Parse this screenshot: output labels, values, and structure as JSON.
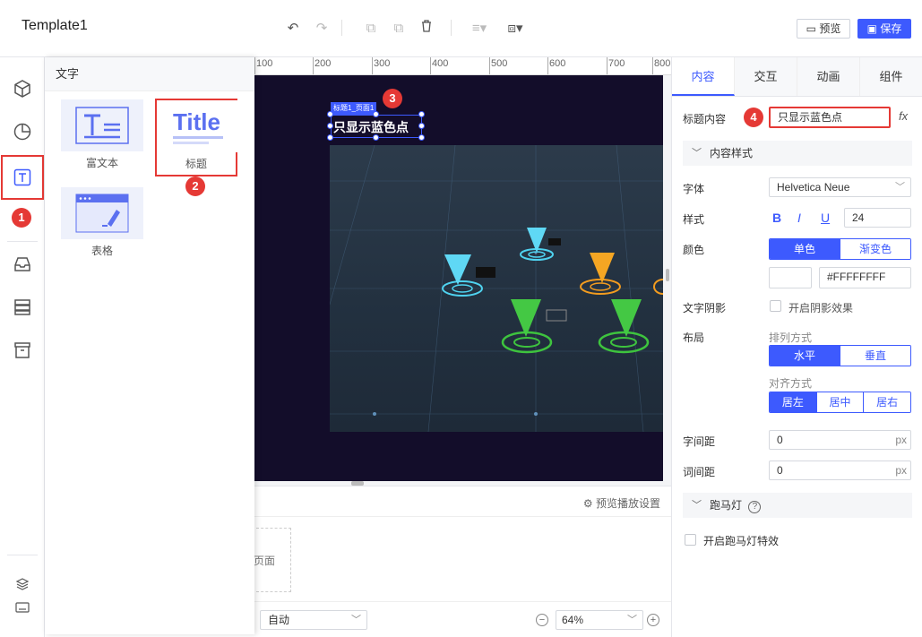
{
  "app": {
    "title": "Template1"
  },
  "toolbar": {
    "undo_icon": "undo-icon",
    "redo_icon": "redo-icon",
    "preview_label": "预览",
    "save_label": "保存"
  },
  "flyout": {
    "header": "文字",
    "items": [
      {
        "label": "富文本",
        "icon": "rich-text-icon"
      },
      {
        "label": "标题",
        "icon": "title-icon",
        "thumb_text": "Title"
      },
      {
        "label": "表格",
        "icon": "table-icon"
      }
    ]
  },
  "ruler": {
    "labels": [
      "200",
      "100",
      "100",
      "200",
      "300",
      "400",
      "500",
      "600",
      "700",
      "800"
    ]
  },
  "canvas": {
    "widget_tag": "标题1_页面1",
    "widget_text": "只显示蓝色点"
  },
  "badges": [
    "1",
    "2",
    "3",
    "4"
  ],
  "bottom": {
    "play_settings": "预览播放设置",
    "page_label": "页面",
    "auto_value": "自动",
    "zoom_value": "64%"
  },
  "panel": {
    "tabs": [
      "内容",
      "交互",
      "动画",
      "组件"
    ],
    "title_content_label": "标题内容",
    "title_content_value": "只显示蓝色点",
    "fx": "fx",
    "content_style_section": "内容样式",
    "font_label": "字体",
    "font_value": "Helvetica Neue",
    "style_label": "样式",
    "bold": "B",
    "italic": "I",
    "underline": "U",
    "font_size": "24",
    "color_label": "颜色",
    "color_modes": [
      "单色",
      "渐变色"
    ],
    "color_hex": "#FFFFFFFF",
    "shadow_label": "文字阴影",
    "shadow_checkbox": "开启阴影效果",
    "layout_label": "布局",
    "arrange_label": "排列方式",
    "arrange_options": [
      "水平",
      "垂直"
    ],
    "align_label": "对齐方式",
    "align_options": [
      "居左",
      "居中",
      "居右"
    ],
    "letter_spacing_label": "字间距",
    "letter_spacing_value": "0",
    "word_spacing_label": "词间距",
    "word_spacing_value": "0",
    "unit": "px",
    "marquee_section": "跑马灯",
    "marquee_checkbox": "开启跑马灯特效"
  },
  "colors": {
    "accent": "#3d5afe",
    "highlight": "#e53935",
    "canvas_bg": "#130d2a",
    "marker_cyan": "#4fd3f0",
    "marker_orange": "#f39c1f",
    "marker_green": "#3ec43e"
  }
}
